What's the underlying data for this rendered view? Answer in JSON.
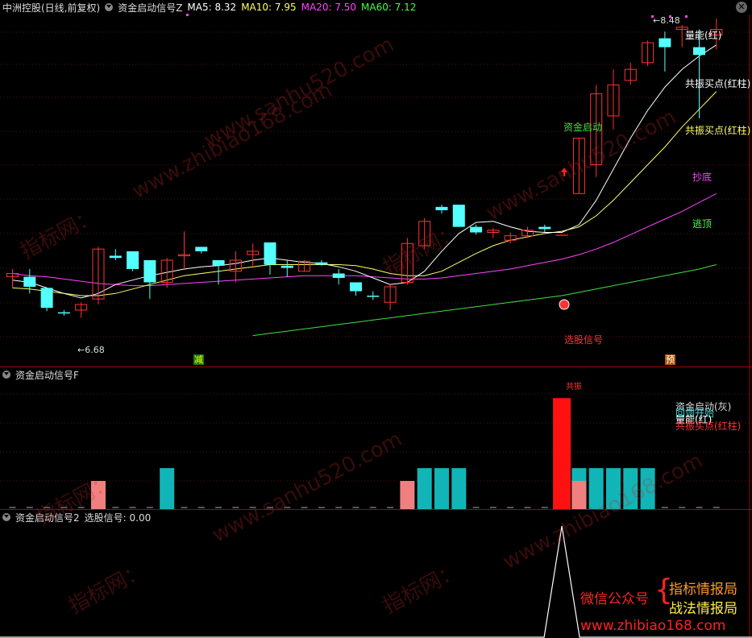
{
  "main": {
    "title": "中洲控股(日线,前复权)",
    "indicator": "资金启动信号Z",
    "ma": [
      {
        "label": "MA5: 8.32",
        "color": "#ffffff"
      },
      {
        "label": "MA10: 7.95",
        "color": "#ffff66"
      },
      {
        "label": "MA20: 7.50",
        "color": "#ff44ff"
      },
      {
        "label": "MA60: 7.12",
        "color": "#44ff44"
      }
    ],
    "high_label": "8.48",
    "low_label": "6.68",
    "legend": [
      {
        "text": "量能(红)",
        "color": "#ffffff"
      },
      {
        "text": "共振买点(红柱)",
        "color": "#ffffff"
      },
      {
        "text": "共振买点(红柱)",
        "color": "#ffff66"
      },
      {
        "text": "抄底",
        "color": "#ff44ff"
      },
      {
        "text": "逃顶",
        "color": "#44ff44"
      }
    ],
    "signal_text": "资金启动",
    "select_text": "选股信号",
    "mark_jian": "减",
    "mark_yu": "预"
  },
  "sub1": {
    "title": "资金启动信号F",
    "top_label": "共振",
    "legend": [
      {
        "text": "资金启动(灰)",
        "color": "#dddddd"
      },
      {
        "text": "回调开始",
        "color": "#44cccc"
      },
      {
        "text": "量能(红)",
        "color": "#ffffff"
      },
      {
        "text": "共振买点(红柱)",
        "color": "#ff3333"
      }
    ]
  },
  "sub2": {
    "title": "资金启动信号2",
    "value_label": "选股信号: 0.00"
  },
  "ad": {
    "wechat": "微信公众号",
    "line1": "指标情报局",
    "line2": "战法情报局",
    "url": "www.zhibiao168.com"
  },
  "watermarks": [
    "www.zhibiao168.com",
    "www.sanhu520.com",
    "指标网：",
    "www.zhibiao168.com",
    "www.sanhu520.com",
    "指标网：",
    "指标网：",
    "www.sanhu520.com",
    "指标网：",
    "指标网："
  ],
  "chart_data": {
    "type": "candlestick",
    "candles": [
      {
        "o": 7.05,
        "h": 7.12,
        "l": 6.95,
        "c": 7.08
      },
      {
        "o": 7.05,
        "h": 7.12,
        "l": 6.9,
        "c": 6.96
      },
      {
        "o": 6.95,
        "h": 6.95,
        "l": 6.74,
        "c": 6.77
      },
      {
        "o": 6.73,
        "h": 6.75,
        "l": 6.7,
        "c": 6.72
      },
      {
        "o": 6.75,
        "h": 6.82,
        "l": 6.68,
        "c": 6.8
      },
      {
        "o": 6.85,
        "h": 7.32,
        "l": 6.8,
        "c": 7.3
      },
      {
        "o": 7.24,
        "h": 7.3,
        "l": 7.2,
        "c": 7.22
      },
      {
        "o": 7.28,
        "h": 7.28,
        "l": 7.1,
        "c": 7.12
      },
      {
        "o": 7.2,
        "h": 7.2,
        "l": 6.85,
        "c": 7.0
      },
      {
        "o": 7.0,
        "h": 7.22,
        "l": 6.95,
        "c": 7.2
      },
      {
        "o": 7.25,
        "h": 7.46,
        "l": 7.12,
        "c": 7.25
      },
      {
        "o": 7.32,
        "h": 7.32,
        "l": 7.26,
        "c": 7.28
      },
      {
        "o": 7.2,
        "h": 7.2,
        "l": 6.98,
        "c": 7.15
      },
      {
        "o": 7.1,
        "h": 7.28,
        "l": 7.0,
        "c": 7.2
      },
      {
        "o": 7.25,
        "h": 7.35,
        "l": 7.15,
        "c": 7.28
      },
      {
        "o": 7.36,
        "h": 7.36,
        "l": 7.07,
        "c": 7.16
      },
      {
        "o": 7.15,
        "h": 7.2,
        "l": 7.05,
        "c": 7.13
      },
      {
        "o": 7.1,
        "h": 7.2,
        "l": 7.1,
        "c": 7.19
      },
      {
        "o": 7.18,
        "h": 7.2,
        "l": 7.15,
        "c": 7.16
      },
      {
        "o": 7.08,
        "h": 7.12,
        "l": 6.98,
        "c": 7.04
      },
      {
        "o": 7.0,
        "h": 7.0,
        "l": 6.88,
        "c": 6.92
      },
      {
        "o": 6.88,
        "h": 6.92,
        "l": 6.84,
        "c": 6.87
      },
      {
        "o": 6.82,
        "h": 6.98,
        "l": 6.75,
        "c": 6.96
      },
      {
        "o": 7.0,
        "h": 7.4,
        "l": 6.98,
        "c": 7.35
      },
      {
        "o": 7.33,
        "h": 7.58,
        "l": 7.3,
        "c": 7.55
      },
      {
        "o": 7.68,
        "h": 7.7,
        "l": 7.62,
        "c": 7.65
      },
      {
        "o": 7.7,
        "h": 7.7,
        "l": 7.5,
        "c": 7.5
      },
      {
        "o": 7.5,
        "h": 7.52,
        "l": 7.43,
        "c": 7.45
      },
      {
        "o": 7.45,
        "h": 7.49,
        "l": 7.4,
        "c": 7.47
      },
      {
        "o": 7.38,
        "h": 7.45,
        "l": 7.35,
        "c": 7.42
      },
      {
        "o": 7.42,
        "h": 7.5,
        "l": 7.4,
        "c": 7.47
      },
      {
        "o": 7.5,
        "h": 7.52,
        "l": 7.45,
        "c": 7.48
      },
      {
        "o": 7.43,
        "h": 7.43,
        "l": 7.42,
        "c": 7.42
      },
      {
        "o": 7.8,
        "h": 8.03,
        "l": 7.8,
        "c": 8.3
      },
      {
        "o": 8.06,
        "h": 8.78,
        "l": 7.95,
        "c": 8.7
      },
      {
        "o": 8.5,
        "h": 8.92,
        "l": 8.38,
        "c": 8.78
      },
      {
        "o": 8.82,
        "h": 8.98,
        "l": 8.78,
        "c": 8.92
      },
      {
        "o": 8.98,
        "h": 9.18,
        "l": 8.95,
        "c": 9.16
      },
      {
        "o": 9.2,
        "h": 9.26,
        "l": 8.9,
        "c": 9.12
      },
      {
        "o": 9.28,
        "h": 9.32,
        "l": 9.12,
        "c": 9.3
      },
      {
        "o": 9.12,
        "h": 9.28,
        "l": 8.48,
        "c": 9.05
      },
      {
        "o": 9.23,
        "h": 9.38,
        "l": 9.1,
        "c": 9.28
      }
    ],
    "ma5": [
      7.02,
      7.0,
      6.95,
      6.9,
      6.86,
      6.9,
      6.98,
      7.02,
      7.06,
      7.09,
      7.12,
      7.14,
      7.15,
      7.17,
      7.2,
      7.22,
      7.2,
      7.18,
      7.17,
      7.14,
      7.1,
      7.04,
      6.98,
      7.0,
      7.1,
      7.28,
      7.44,
      7.54,
      7.55,
      7.5,
      7.46,
      7.45,
      7.45,
      7.52,
      7.74,
      8.02,
      8.3,
      8.55,
      8.76,
      8.92,
      9.04,
      9.14
    ],
    "ma10": [
      6.95,
      6.94,
      6.92,
      6.9,
      6.88,
      6.88,
      6.9,
      6.94,
      6.98,
      7.02,
      7.06,
      7.08,
      7.1,
      7.12,
      7.14,
      7.16,
      7.16,
      7.16,
      7.16,
      7.16,
      7.15,
      7.12,
      7.08,
      7.06,
      7.06,
      7.1,
      7.18,
      7.26,
      7.33,
      7.38,
      7.41,
      7.44,
      7.46,
      7.5,
      7.6,
      7.74,
      7.9,
      8.06,
      8.22,
      8.4,
      8.56,
      8.72
    ],
    "ma20": [
      7.08,
      7.06,
      7.05,
      7.03,
      7.01,
      6.99,
      6.98,
      6.97,
      6.97,
      6.98,
      6.99,
      7.0,
      7.01,
      7.02,
      7.03,
      7.04,
      7.05,
      7.06,
      7.06,
      7.06,
      7.06,
      7.05,
      7.04,
      7.03,
      7.03,
      7.04,
      7.06,
      7.08,
      7.1,
      7.12,
      7.15,
      7.18,
      7.21,
      7.25,
      7.3,
      7.36,
      7.43,
      7.5,
      7.57,
      7.64,
      7.72,
      7.8
    ],
    "ma60": [
      null,
      null,
      null,
      null,
      null,
      null,
      null,
      null,
      null,
      null,
      null,
      null,
      null,
      null,
      6.52,
      6.54,
      6.56,
      6.58,
      6.6,
      6.62,
      6.64,
      6.66,
      6.68,
      6.7,
      6.72,
      6.74,
      6.76,
      6.78,
      6.8,
      6.82,
      6.84,
      6.86,
      6.88,
      6.91,
      6.94,
      6.97,
      7.0,
      7.03,
      7.06,
      7.09,
      7.12,
      7.16
    ],
    "sub1_bars": [
      {
        "i": 5,
        "v": 0.33,
        "color": "#f08080"
      },
      {
        "i": 9,
        "v": 0.48,
        "color": "#11b5b8"
      },
      {
        "i": 23,
        "v": 0.33,
        "color": "#f08080"
      },
      {
        "i": 24,
        "v": 0.48,
        "color": "#11b5b8"
      },
      {
        "i": 25,
        "v": 0.48,
        "color": "#11b5b8"
      },
      {
        "i": 26,
        "v": 0.48,
        "color": "#11b5b8"
      },
      {
        "i": 32,
        "v": 1.3,
        "color": "#ff1111"
      },
      {
        "i": 33,
        "v": 0.48,
        "color": "#11b5b8"
      },
      {
        "i": 33,
        "v": 0.33,
        "color": "#f08080"
      },
      {
        "i": 34,
        "v": 0.48,
        "color": "#11b5b8"
      },
      {
        "i": 35,
        "v": 0.48,
        "color": "#11b5b8"
      },
      {
        "i": 36,
        "v": 0.48,
        "color": "#11b5b8"
      },
      {
        "i": 37,
        "v": 0.48,
        "color": "#11b5b8"
      }
    ],
    "sub2_signal_index": 32
  }
}
